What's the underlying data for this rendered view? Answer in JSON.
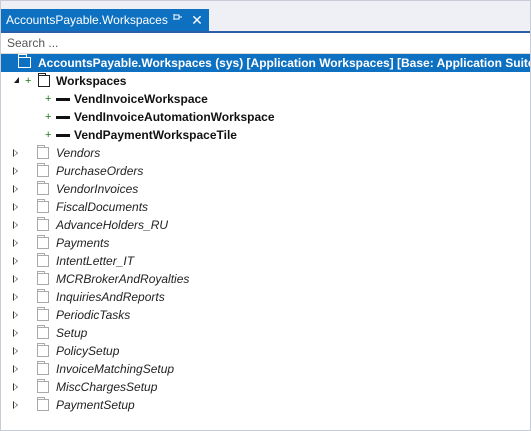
{
  "tab": {
    "title": "AccountsPayable.Workspaces",
    "pin_icon": "pin-icon",
    "close_glyph": "✕"
  },
  "search": {
    "placeholder": "Search ..."
  },
  "tree": {
    "root": {
      "label": "AccountsPayable.Workspaces (sys) [Application Workspaces] [Base: Application Suite]"
    },
    "workspaces": {
      "label": "Workspaces"
    },
    "workspace_items": [
      {
        "label": "VendInvoiceWorkspace"
      },
      {
        "label": "VendInvoiceAutomationWorkspace"
      },
      {
        "label": "VendPaymentWorkspaceTile"
      }
    ],
    "folders": [
      {
        "label": "Vendors"
      },
      {
        "label": "PurchaseOrders"
      },
      {
        "label": "VendorInvoices"
      },
      {
        "label": "FiscalDocuments"
      },
      {
        "label": "AdvanceHolders_RU"
      },
      {
        "label": "Payments"
      },
      {
        "label": "IntentLetter_IT"
      },
      {
        "label": "MCRBrokerAndRoyalties"
      },
      {
        "label": "InquiriesAndReports"
      },
      {
        "label": "PeriodicTasks"
      },
      {
        "label": "Setup"
      },
      {
        "label": "PolicySetup"
      },
      {
        "label": "InvoiceMatchingSetup"
      },
      {
        "label": "MiscChargesSetup"
      },
      {
        "label": "PaymentSetup"
      }
    ]
  },
  "colors": {
    "accent": "#0e70c0",
    "tab_border": "#2c5ea8",
    "plus": "#1e7a1e"
  }
}
